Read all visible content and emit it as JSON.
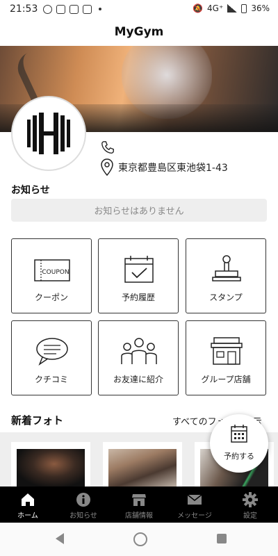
{
  "status_bar": {
    "time": "21:53",
    "network": "4G⁺",
    "battery": "36%"
  },
  "app": {
    "title": "MyGym"
  },
  "gym": {
    "address": "東京都豊島区東池袋1-43"
  },
  "notices": {
    "heading": "お知らせ",
    "empty_text": "お知らせはありません"
  },
  "menu": {
    "tiles": [
      {
        "label": "クーポン",
        "icon": "coupon-icon",
        "coupon_text": "COUPON"
      },
      {
        "label": "予約履歴",
        "icon": "calendar-check-icon"
      },
      {
        "label": "スタンプ",
        "icon": "stamp-icon"
      },
      {
        "label": "クチコミ",
        "icon": "chat-bubble-icon"
      },
      {
        "label": "お友達に紹介",
        "icon": "people-icon"
      },
      {
        "label": "グループ店舗",
        "icon": "storefront-icon"
      }
    ]
  },
  "photos": {
    "heading": "新着フォト",
    "see_all": "すべてのフォトを表示"
  },
  "fab": {
    "label": "予約する"
  },
  "tabbar": {
    "items": [
      {
        "label": "ホーム",
        "icon": "home-icon",
        "active": true
      },
      {
        "label": "お知らせ",
        "icon": "info-icon",
        "active": false
      },
      {
        "label": "店舗情報",
        "icon": "store-icon",
        "active": false
      },
      {
        "label": "メッセージ",
        "icon": "mail-icon",
        "active": false
      },
      {
        "label": "設定",
        "icon": "gear-icon",
        "active": false
      }
    ]
  }
}
